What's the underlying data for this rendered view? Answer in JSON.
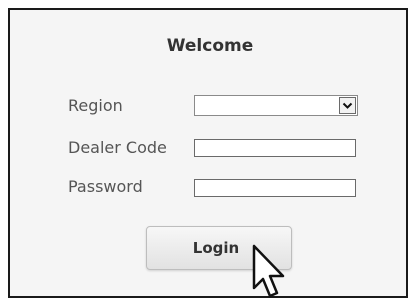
{
  "form": {
    "title": "Welcome",
    "region_label": "Region",
    "region_value": "",
    "dealer_code_label": "Dealer Code",
    "dealer_code_value": "",
    "password_label": "Password",
    "password_value": "",
    "login_label": "Login"
  },
  "icons": {
    "dropdown": "chevron-down-icon",
    "pointer": "mouse-pointer-icon"
  },
  "colors": {
    "panel_background": "#f5f5f5",
    "panel_border": "#1a1a1a",
    "label_text": "#555555",
    "button_background": "#e8e8e8"
  }
}
